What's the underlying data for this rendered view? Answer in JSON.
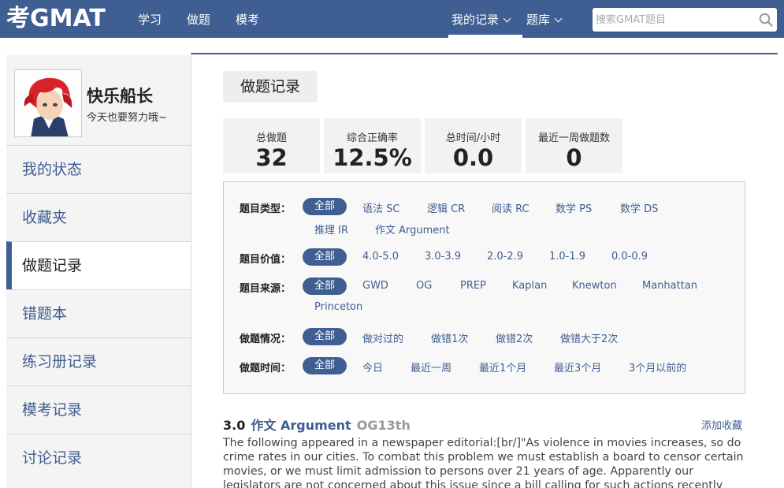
{
  "header": {
    "logo": "考GMAT",
    "nav": [
      "学习",
      "做题",
      "模考"
    ],
    "my_records": "我的记录",
    "question_bank": "题库",
    "search_placeholder": "搜索GMAT题目"
  },
  "profile": {
    "name": "快乐船长",
    "signature": "今天也要努力哦~"
  },
  "sidebar": {
    "items": [
      {
        "label": "我的状态"
      },
      {
        "label": "收藏夹"
      },
      {
        "label": "做题记录"
      },
      {
        "label": "错题本"
      },
      {
        "label": "练习册记录"
      },
      {
        "label": "模考记录"
      },
      {
        "label": "讨论记录"
      }
    ],
    "active": "做题记录"
  },
  "main": {
    "title": "做题记录",
    "stats": [
      {
        "label": "总做题",
        "value": "32"
      },
      {
        "label": "综合正确率",
        "value": "12.5%"
      },
      {
        "label": "总时间/小时",
        "value": "0.0"
      },
      {
        "label": "最近一周做题数",
        "value": "0"
      }
    ],
    "filters": {
      "type": {
        "label": "题目类型：",
        "selected": "全部",
        "options": [
          "语法 SC",
          "逻辑 CR",
          "阅读 RC",
          "数学 PS",
          "数学 DS",
          "推理 IR",
          "作文 Argument"
        ]
      },
      "value": {
        "label": "题目价值：",
        "selected": "全部",
        "options": [
          "4.0-5.0",
          "3.0-3.9",
          "2.0-2.9",
          "1.0-1.9",
          "0.0-0.9"
        ]
      },
      "source": {
        "label": "题目来源：",
        "selected": "全部",
        "options": [
          "GWD",
          "OG",
          "PREP",
          "Kaplan",
          "Knewton",
          "Manhattan",
          "Princeton"
        ]
      },
      "status": {
        "label": "做题情况：",
        "selected": "全部",
        "options": [
          "做对过的",
          "做错1次",
          "做错2次",
          "做错大于2次"
        ]
      },
      "time": {
        "label": "做题时间：",
        "selected": "全部",
        "options": [
          "今日",
          "最近一周",
          "最近1个月",
          "最近3个月",
          "3个月以前的"
        ]
      }
    },
    "question": {
      "score": "3.0",
      "type": "作文 Argument",
      "source": "OG13th",
      "favorite": "添加收藏",
      "text": "The following appeared in a newspaper editorial:[br/]\"As violence in movies increases, so do crime rates in our cities. To combat this problem we must establish a board to censor certain movies, or we must limit admission to persons over 21 years of age. Apparently our legislators are not concerned about this issue since a bill calling for such actions recently failed to receive a majority"
    }
  },
  "colors": {
    "brand": "#3f5e91",
    "panel_bg": "#f4f4f4"
  }
}
